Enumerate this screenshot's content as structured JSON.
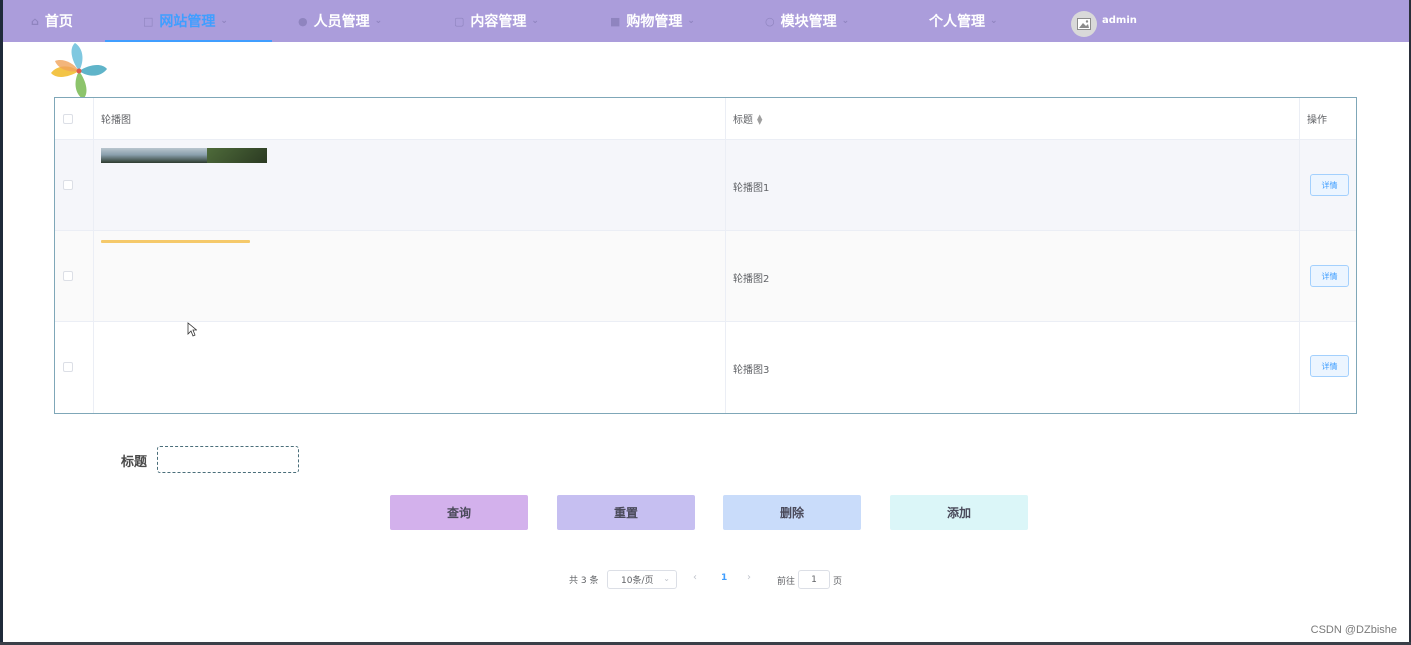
{
  "nav": {
    "items": [
      {
        "label": "首页",
        "icon": "home-icon",
        "active": false
      },
      {
        "label": "网站管理",
        "icon": "monitor-icon",
        "active": true
      },
      {
        "label": "人员管理",
        "icon": "user-icon",
        "active": false
      },
      {
        "label": "内容管理",
        "icon": "document-icon",
        "active": false
      },
      {
        "label": "购物管理",
        "icon": "bag-icon",
        "active": false
      },
      {
        "label": "模块管理",
        "icon": "chat-icon",
        "active": false
      },
      {
        "label": "个人管理",
        "icon": "",
        "active": false
      }
    ],
    "user": "admin",
    "accent_color": "#409eff",
    "bar_color": "#ab9ddb"
  },
  "table": {
    "headers": {
      "image": "轮播图",
      "title": "标题",
      "action": "操作"
    },
    "rows": [
      {
        "title": "轮播图1",
        "action": "详情"
      },
      {
        "title": "轮播图2",
        "action": "详情"
      },
      {
        "title": "轮播图3",
        "action": "详情"
      }
    ]
  },
  "search": {
    "label": "标题",
    "value": ""
  },
  "buttons": {
    "query": "查询",
    "reset": "重置",
    "delete": "删除",
    "add": "添加"
  },
  "pagination": {
    "total": "共 3 条",
    "page_size": "10条/页",
    "current": "1",
    "goto_label": "前往",
    "goto_value": "1",
    "page_suffix": "页"
  },
  "watermark": "CSDN @DZbishe"
}
